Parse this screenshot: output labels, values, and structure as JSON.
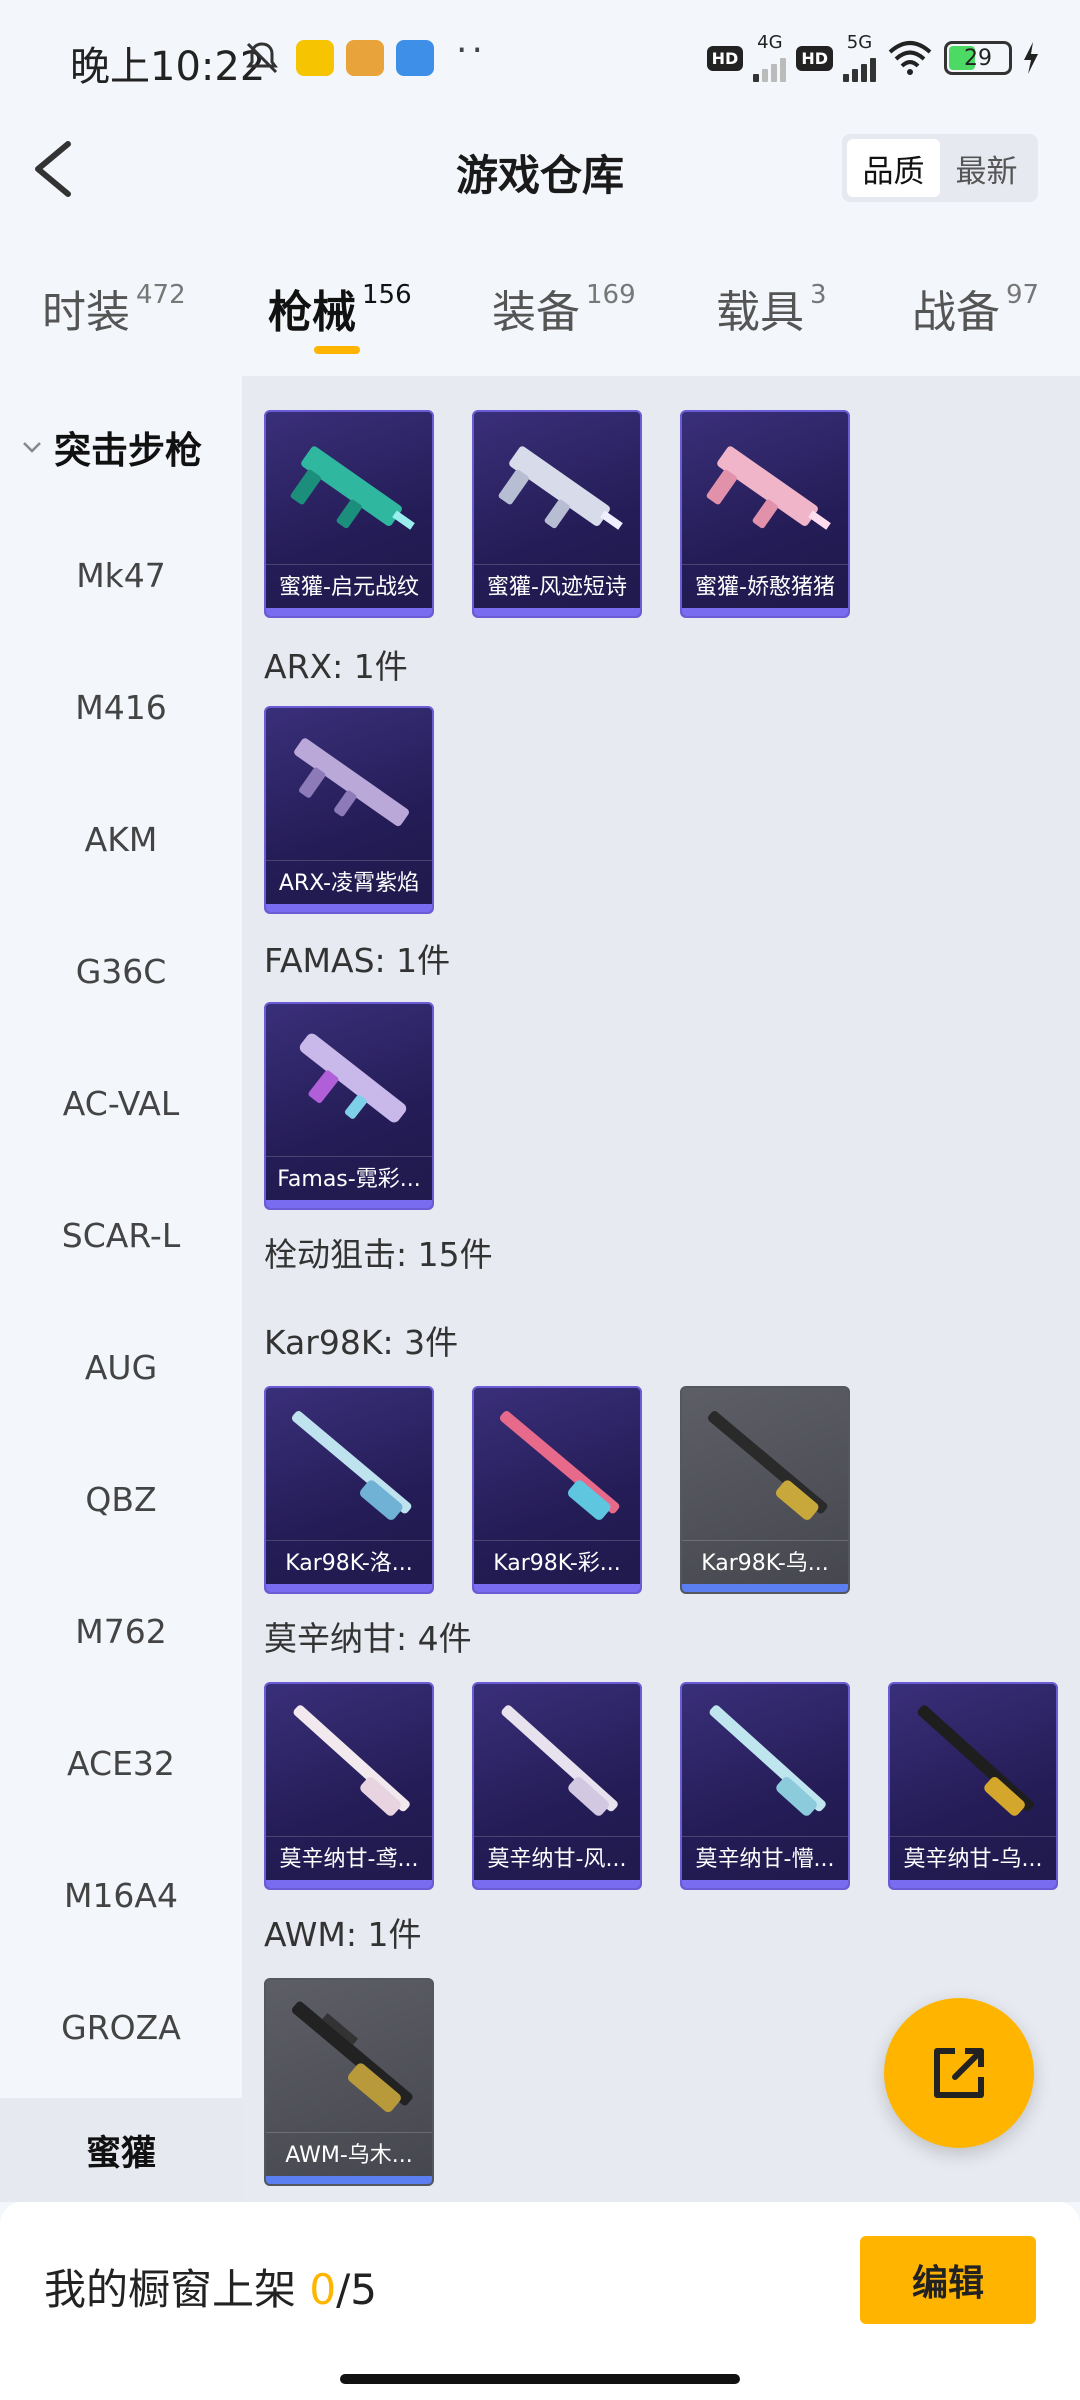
{
  "status_bar": {
    "time": "晚上10:22",
    "net1": "4G",
    "net2": "5G",
    "hd": "HD",
    "battery": "29"
  },
  "header": {
    "title": "游戏仓库",
    "sort_options": [
      "品质",
      "最新"
    ],
    "sort_selected": "品质"
  },
  "tabs": [
    {
      "label": "时装",
      "count": "472"
    },
    {
      "label": "枪械",
      "count": "156",
      "active": true
    },
    {
      "label": "装备",
      "count": "169"
    },
    {
      "label": "载具",
      "count": "3"
    },
    {
      "label": "战备",
      "count": "97"
    }
  ],
  "sidebar": {
    "group": "突击步枪",
    "items": [
      "Mk47",
      "M416",
      "AKM",
      "G36C",
      "AC-VAL",
      "SCAR-L",
      "AUG",
      "QBZ",
      "M762",
      "ACE32",
      "M16A4",
      "GROZA"
    ],
    "selected": "蜜獾"
  },
  "content": {
    "sections": [
      {
        "title": "",
        "items": [
          "蜜獾-启元战纹",
          "蜜獾-风迹短诗",
          "蜜獾-娇憨猪猪"
        ]
      },
      {
        "title": "ARX: 1件",
        "items": [
          "ARX-凌霄紫焰"
        ]
      },
      {
        "title": "FAMAS: 1件",
        "items": [
          "Famas-霓彩..."
        ]
      },
      {
        "title": "栓动狙击: 15件",
        "items": []
      },
      {
        "title": "Kar98K: 3件",
        "items": [
          "Kar98K-洛...",
          "Kar98K-彩...",
          "Kar98K-乌..."
        ]
      },
      {
        "title": "莫辛纳甘: 4件",
        "items": [
          "莫辛纳甘-鸢...",
          "莫辛纳甘-风...",
          "莫辛纳甘-懵...",
          "莫辛纳甘-乌..."
        ]
      },
      {
        "title": "AWM: 1件",
        "items": [
          "AWM-乌木..."
        ]
      }
    ]
  },
  "bottom": {
    "shelf_label": "我的橱窗上架",
    "shelf_current": "0",
    "shelf_total": "/5",
    "edit_label": "编辑"
  },
  "colors": {
    "accent": "#ffb400",
    "card_purple": "#2b2266",
    "card_gray": "#4f5058"
  }
}
